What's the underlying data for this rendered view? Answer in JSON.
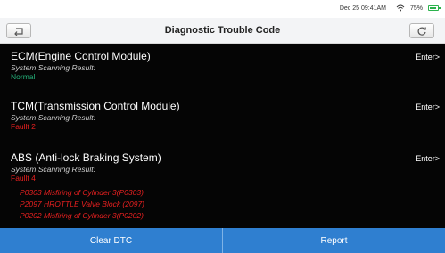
{
  "status_bar": {
    "time": "Dec 25 09:41AM",
    "battery": "75%",
    "icons": {
      "wifi": "wifi-icon",
      "battery": "battery-icon"
    },
    "battery_color": "#2bb24c"
  },
  "header": {
    "title": "Diagnostic Trouble Code",
    "back_icon": "back-arrow-icon",
    "refresh_icon": "refresh-icon"
  },
  "modules": [
    {
      "name": "ECM(Engine Control Module)",
      "scan_label": "System Scanning Result:",
      "result": "Normal",
      "result_color": "#25b27a",
      "enter": "Enter>",
      "faults": []
    },
    {
      "name": "TCM(Transmission Control Module)",
      "scan_label": "System Scanning Result:",
      "result": "Faullt 2",
      "result_color": "#e82020",
      "enter": "Enter>",
      "faults": []
    },
    {
      "name": "ABS (Anti-lock Braking System)",
      "scan_label": "System Scanning Result:",
      "result": "Faullt 4",
      "result_color": "#e82020",
      "enter": "Enter>",
      "faults": [
        "P0303 Misfiring of Cylinder 3(P0303)",
        "P2097 HROTTLE Valve Block (2097)",
        "P0202 Misfiring of Cylinder 3(P0202)"
      ]
    }
  ],
  "footer": {
    "clear_label": "Clear DTC",
    "report_label": "Report",
    "color": "#2f7fd0"
  }
}
